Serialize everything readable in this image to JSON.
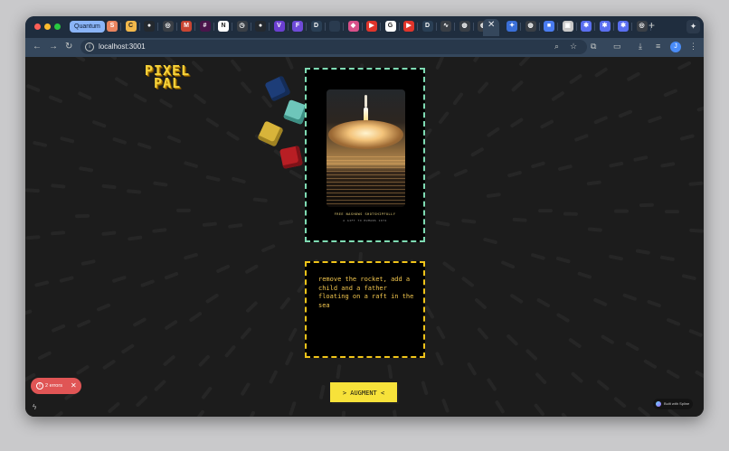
{
  "browser": {
    "tab_group_label": "Quantum",
    "url": "localhost:3001",
    "tabs": [
      {
        "icon": "s-icon",
        "glyph": "S",
        "color": "#e8845f"
      },
      {
        "icon": "c-icon",
        "glyph": "C",
        "color": "#f2b84b"
      },
      {
        "icon": "github-icon",
        "glyph": "●",
        "color": "#24292f"
      },
      {
        "icon": "openai-icon",
        "glyph": "◎",
        "color": "#3a3f46"
      },
      {
        "icon": "gmail-icon",
        "glyph": "M",
        "color": "#c84532"
      },
      {
        "icon": "slack-icon",
        "glyph": "#",
        "color": "#4a154b"
      },
      {
        "icon": "notion-icon",
        "glyph": "N",
        "color": "#ffffff"
      },
      {
        "icon": "clock-icon",
        "glyph": "◷",
        "color": "#3a3f46"
      },
      {
        "icon": "github-icon",
        "glyph": "●",
        "color": "#24292f"
      },
      {
        "icon": "v-icon",
        "glyph": "V",
        "color": "#6b3fd1"
      },
      {
        "icon": "f-icon",
        "glyph": "F",
        "color": "#6f4bd8"
      },
      {
        "icon": "d-icon",
        "glyph": "D",
        "color": "#2a3f55"
      },
      {
        "icon": "blank-icon",
        "glyph": "",
        "color": "#2a3b4f"
      },
      {
        "icon": "app-icon",
        "glyph": "◆",
        "color": "#d9508a"
      },
      {
        "icon": "youtube-icon",
        "glyph": "▶",
        "color": "#e0352b"
      },
      {
        "icon": "google-icon",
        "glyph": "G",
        "color": "#ffffff"
      },
      {
        "icon": "youtube-icon",
        "glyph": "▶",
        "color": "#e0352b"
      },
      {
        "icon": "d-icon",
        "glyph": "D",
        "color": "#2a3f55"
      },
      {
        "icon": "waveform-icon",
        "glyph": "∿",
        "color": "#3a3f46"
      },
      {
        "icon": "globe-icon",
        "glyph": "◍",
        "color": "#3a3f46"
      },
      {
        "icon": "globe-icon",
        "glyph": "◍",
        "color": "#3a3f46"
      },
      {
        "icon": "sparkle-icon",
        "glyph": "✦",
        "color": "#3a6fd8"
      },
      {
        "icon": "globe-icon",
        "glyph": "◍",
        "color": "#3a3f46"
      },
      {
        "icon": "app-blue-icon",
        "glyph": "■",
        "color": "#4a7cf0"
      },
      {
        "icon": "image-icon",
        "glyph": "▣",
        "color": "#c8c8c8"
      },
      {
        "icon": "gear-icon",
        "glyph": "✱",
        "color": "#5a6ff0"
      },
      {
        "icon": "gear-icon",
        "glyph": "✱",
        "color": "#5a6ff0"
      },
      {
        "icon": "gear-icon",
        "glyph": "✱",
        "color": "#5a6ff0"
      },
      {
        "icon": "openai-icon",
        "glyph": "◎",
        "color": "#3a3f46"
      }
    ],
    "close_tab_glyph": "✕",
    "new_tab_glyph": "+",
    "profile_initial": "J"
  },
  "app": {
    "logo_line1": "PIXEL",
    "logo_line2": "PAL",
    "image_caption": "FREE NASHOWS SHOTSHIPFULLY",
    "image_subcaption": "A GIFT TO HUMANS 1974",
    "prompt": "remove the rocket, add a child and a father floating on a raft in the sea",
    "augment_label": "> AUGMENT <",
    "errors_label": "2 errors",
    "spline_badge": "Built with Spline"
  },
  "colors": {
    "accent_yellow": "#f7e23a",
    "frame_green": "#7fdcb4",
    "frame_yellow": "#f0c419",
    "error_red": "#e05555"
  }
}
